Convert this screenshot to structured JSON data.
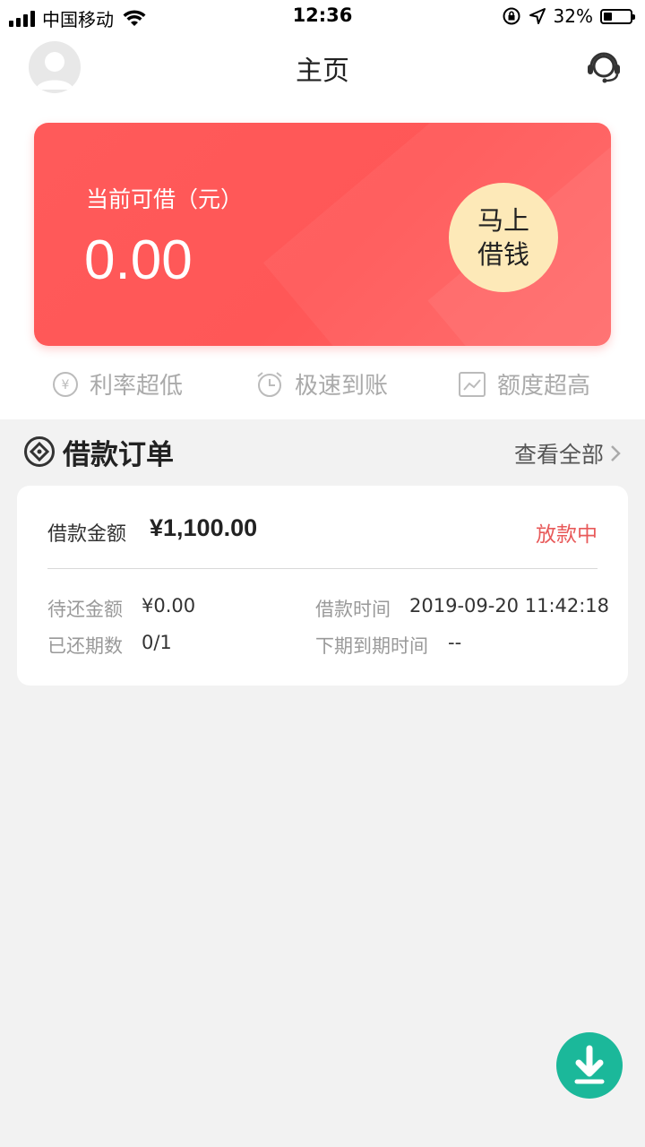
{
  "status_bar": {
    "carrier": "中国移动",
    "time": "12:36",
    "battery_percent": "32%",
    "battery_level": 0.32
  },
  "header": {
    "title": "主页"
  },
  "credit_card": {
    "label": "当前可借（元）",
    "amount": "0.00",
    "button_line1": "马上",
    "button_line2": "借钱"
  },
  "features": [
    {
      "icon": "yen-coin-icon",
      "label": "利率超低"
    },
    {
      "icon": "alarm-clock-icon",
      "label": "极速到账"
    },
    {
      "icon": "trend-chart-icon",
      "label": "额度超高"
    }
  ],
  "orders": {
    "title": "借款订单",
    "view_all": "查看全部",
    "order": {
      "amount_label": "借款金额",
      "amount": "¥1,100.00",
      "status": "放款中",
      "pending_label": "待还金额",
      "pending_value": "¥0.00",
      "time_label": "借款时间",
      "time_value": "2019-09-20 11:42:18",
      "periods_label": "已还期数",
      "periods_value": "0/1",
      "next_due_label": "下期到期时间",
      "next_due_value": "--"
    }
  },
  "colors": {
    "card_red": "#ff5a5a",
    "button_cream": "#fde9b8",
    "status_red": "#e85a5a",
    "fab_green": "#1bb89a"
  }
}
